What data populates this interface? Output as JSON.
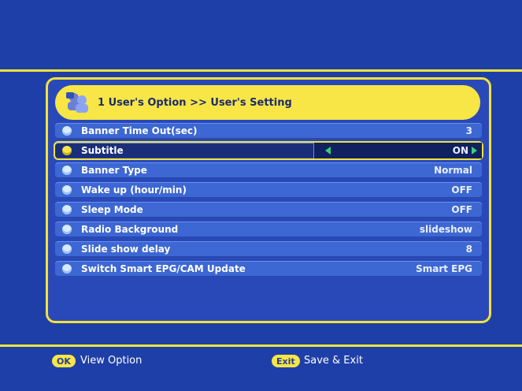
{
  "header": {
    "title": "1  User's Option >> User's Setting"
  },
  "rows": [
    {
      "label": "Banner Time Out(sec)",
      "value": "3"
    },
    {
      "label": "Subtitle",
      "value": "ON"
    },
    {
      "label": "Banner Type",
      "value": "Normal"
    },
    {
      "label": "Wake up (hour/min)",
      "value": "OFF"
    },
    {
      "label": "Sleep Mode",
      "value": "OFF"
    },
    {
      "label": "Radio Background",
      "value": "slideshow"
    },
    {
      "label": "Slide show delay",
      "value": "8"
    },
    {
      "label": "Switch Smart EPG/CAM Update",
      "value": "Smart EPG"
    }
  ],
  "footer": {
    "ok_key": "OK",
    "ok_label": "View Option",
    "exit_key": "Exit",
    "exit_label": "Save & Exit"
  },
  "colors": {
    "background": "#1f3fa8",
    "accent": "#f2e23a",
    "row": "#3d67d2",
    "selected_row": "#1a2e7a",
    "arrow": "#36d27b"
  }
}
